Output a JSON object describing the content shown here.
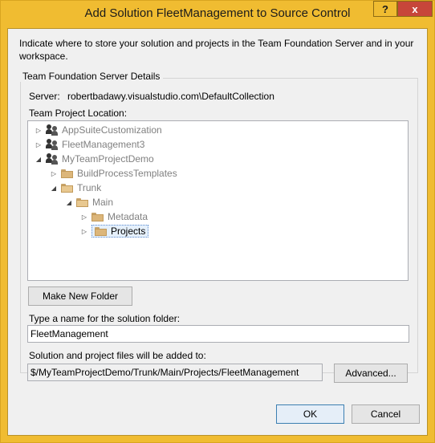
{
  "window": {
    "title": "Add Solution FleetManagement to Source Control",
    "help_label": "?",
    "close_label": "x"
  },
  "intro": "Indicate where to store your solution and projects in the Team Foundation Server and in your workspace.",
  "group": {
    "title": "Team Foundation Server Details",
    "server_label": "Server:",
    "server_value": "robertbadawy.visualstudio.com\\DefaultCollection",
    "location_label": "Team Project Location:"
  },
  "tree": [
    {
      "label": "AppSuiteCustomization",
      "expander": "▷",
      "icon": "team-project-icon"
    },
    {
      "label": "FleetManagement3",
      "expander": "▷",
      "icon": "team-project-icon"
    },
    {
      "label": "MyTeamProjectDemo",
      "expander": "◢",
      "icon": "team-project-icon"
    },
    {
      "label": "BuildProcessTemplates",
      "expander": "▷",
      "icon": "folder-icon"
    },
    {
      "label": "Trunk",
      "expander": "◢",
      "icon": "folder-open-icon"
    },
    {
      "label": "Main",
      "expander": "◢",
      "icon": "folder-open-icon"
    },
    {
      "label": "Metadata",
      "expander": "▷",
      "icon": "folder-icon"
    },
    {
      "label": "Projects",
      "expander": "▷",
      "icon": "folder-icon"
    }
  ],
  "buttons": {
    "make_new_folder": "Make New Folder",
    "advanced": "Advanced...",
    "ok": "OK",
    "cancel": "Cancel"
  },
  "solution_folder": {
    "label": "Type a name for the solution folder:",
    "value": "FleetManagement"
  },
  "files_path": {
    "label": "Solution and project files will be added to:",
    "value": "$/MyTeamProjectDemo/Trunk/Main/Projects/FleetManagement"
  }
}
